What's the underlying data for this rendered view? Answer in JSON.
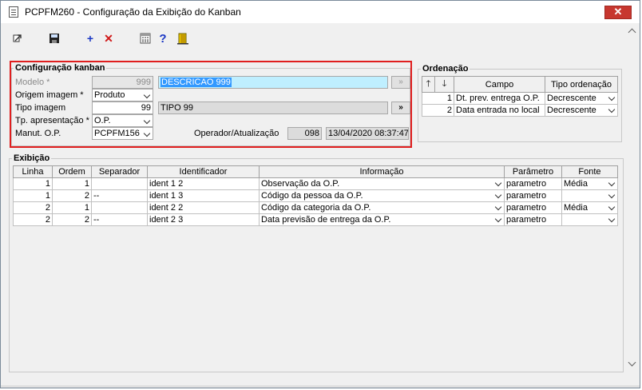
{
  "window": {
    "title": "PCPFM260 - Configuração da Exibição do Kanban",
    "close_label": "✕"
  },
  "toolbar": {
    "items": [
      "exit-icon",
      "save-icon",
      "add-icon",
      "delete-icon",
      "calculator-icon",
      "help-icon",
      "door-icon"
    ],
    "add_label": "+",
    "delete_label": "✕",
    "help_label": "?"
  },
  "config": {
    "title": "Configuração kanban",
    "modelo_label": "Modelo *",
    "modelo_value": "999",
    "modelo_desc": "DESCRICAO 999",
    "origem_label": "Origem imagem *",
    "origem_value": "Produto",
    "tipo_label": "Tipo imagem",
    "tipo_value": "99",
    "tipo_desc": "TIPO 99",
    "tp_label": "Tp. apresentação *",
    "tp_value": "O.P.",
    "manut_label": "Manut. O.P.",
    "manut_value": "PCPFM156",
    "operador_label": "Operador/Atualização",
    "operador_value": "098",
    "atualizacao_value": "13/04/2020 08:37:47",
    "lookup_label": "»"
  },
  "ordenacao": {
    "title": "Ordenação",
    "headers": [
      "",
      "",
      "Campo",
      "Tipo ordenação"
    ],
    "up_label": "🡑",
    "down_label": "🡓",
    "rows": [
      {
        "num": "1",
        "campo": "Dt. prev. entrega O.P.",
        "tipo": "Decrescente"
      },
      {
        "num": "2",
        "campo": "Data entrada no local",
        "tipo": "Decrescente"
      }
    ]
  },
  "exibicao": {
    "title": "Exibição",
    "headers": [
      "Linha",
      "Ordem",
      "Separador",
      "Identificador",
      "Informação",
      "Parâmetro",
      "Fonte"
    ],
    "rows": [
      {
        "linha": "1",
        "ordem": "1",
        "separador": "",
        "identificador": "ident 1 2",
        "informacao": "Observação da O.P.",
        "parametro": "parametro",
        "fonte": "Média"
      },
      {
        "linha": "1",
        "ordem": "2",
        "separador": "--",
        "identificador": "ident 1 3",
        "informacao": "Código da pessoa da O.P.",
        "parametro": "parametro",
        "fonte": ""
      },
      {
        "linha": "2",
        "ordem": "1",
        "separador": "",
        "identificador": "ident 2 2",
        "informacao": "Código da categoria da O.P.",
        "parametro": "parametro",
        "fonte": "Média"
      },
      {
        "linha": "2",
        "ordem": "2",
        "separador": "--",
        "identificador": "ident 2 3",
        "informacao": "Data previsão de entrega da O.P.",
        "parametro": "parametro",
        "fonte": ""
      }
    ]
  },
  "colors": {
    "highlight_box": "#e01f1f",
    "selection": "#3399ff",
    "selection_field": "#bfefff",
    "close_button": "#c7372f"
  }
}
